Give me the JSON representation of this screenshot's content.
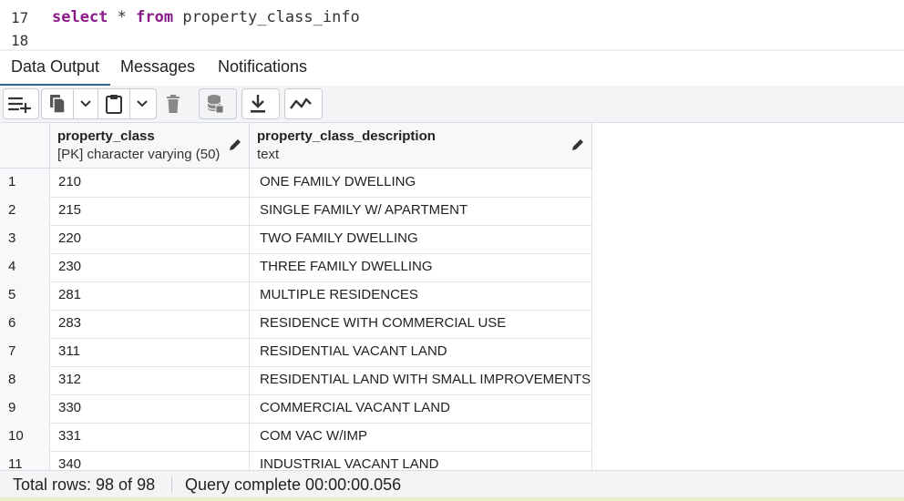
{
  "editor": {
    "lines": [
      {
        "number": "17",
        "keyword1": "select",
        "middle": " * ",
        "keyword2": "from",
        "rest": " property_class_info"
      },
      {
        "number": "18"
      }
    ]
  },
  "tabs": [
    {
      "label": "Data Output",
      "active": true
    },
    {
      "label": "Messages",
      "active": false
    },
    {
      "label": "Notifications",
      "active": false
    }
  ],
  "toolbar": {
    "buttons": [
      "add-row-icon",
      "copy-icon",
      "chevron-down-icon",
      "paste-icon",
      "chevron-down-icon",
      "delete-icon",
      "save-data-icon",
      "download-icon",
      "graph-icon"
    ]
  },
  "grid": {
    "columns": [
      {
        "name": "property_class",
        "type": "[PK] character varying (50)"
      },
      {
        "name": "property_class_description",
        "type": "text"
      }
    ],
    "rows": [
      [
        "1",
        "210",
        "ONE FAMILY DWELLING"
      ],
      [
        "2",
        "215",
        "SINGLE FAMILY W/ APARTMENT"
      ],
      [
        "3",
        "220",
        "TWO FAMILY DWELLING"
      ],
      [
        "4",
        "230",
        "THREE FAMILY DWELLING"
      ],
      [
        "5",
        "281",
        "MULTIPLE RESIDENCES"
      ],
      [
        "6",
        "283",
        "RESIDENCE WITH COMMERCIAL USE"
      ],
      [
        "7",
        "311",
        "RESIDENTIAL VACANT LAND"
      ],
      [
        "8",
        "312",
        "RESIDENTIAL LAND WITH SMALL IMPROVEMENTS"
      ],
      [
        "9",
        "330",
        "COMMERCIAL VACANT LAND"
      ],
      [
        "10",
        "331",
        "COM VAC W/IMP"
      ],
      [
        "11",
        "340",
        "INDUSTRIAL VACANT LAND"
      ]
    ]
  },
  "status": {
    "total_rows": "Total rows: 98 of 98",
    "query": "Query complete 00:00:00.056"
  }
}
